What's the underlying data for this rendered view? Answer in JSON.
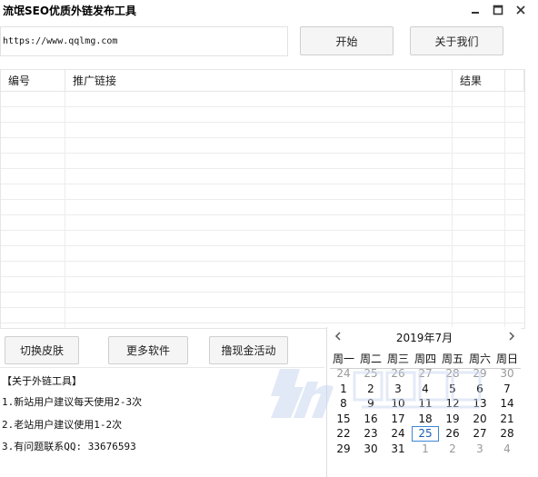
{
  "window": {
    "title": "流氓SEO优质外链发布工具",
    "minimize_icon": "minimize-icon",
    "maximize_icon": "maximize-icon",
    "close_icon": "close-icon"
  },
  "url_input": {
    "value": "https://www.qqlmg.com"
  },
  "buttons": {
    "start": "开始",
    "about": "关于我们",
    "skin": "切换皮肤",
    "more": "更多软件",
    "cash": "撸现金活动"
  },
  "table": {
    "columns": [
      "编号",
      "推广链接",
      "结果",
      ""
    ],
    "rows": []
  },
  "about": {
    "heading": "【关于外链工具】",
    "lines": [
      "1.新站用户建议每天使用2-3次",
      "2.老站用户建议使用1-2次",
      "3.有问题联系QQ: 33676593"
    ]
  },
  "calendar": {
    "title": "2019年7月",
    "prev_icon": "chevron-left-icon",
    "next_icon": "chevron-right-icon",
    "weekdays": [
      "周一",
      "周二",
      "周三",
      "周四",
      "周五",
      "周六",
      "周日"
    ],
    "weeks": [
      [
        "24",
        "25",
        "26",
        "27",
        "28",
        "29",
        "30"
      ],
      [
        "1",
        "2",
        "3",
        "4",
        "5",
        "6",
        "7"
      ],
      [
        "8",
        "9",
        "10",
        "11",
        "12",
        "13",
        "14"
      ],
      [
        "15",
        "16",
        "17",
        "18",
        "19",
        "20",
        "21"
      ],
      [
        "22",
        "23",
        "24",
        "25",
        "26",
        "27",
        "28"
      ],
      [
        "29",
        "30",
        "31",
        "1",
        "2",
        "3",
        "4"
      ]
    ],
    "today": "25",
    "today_color": "#3b86d6"
  }
}
